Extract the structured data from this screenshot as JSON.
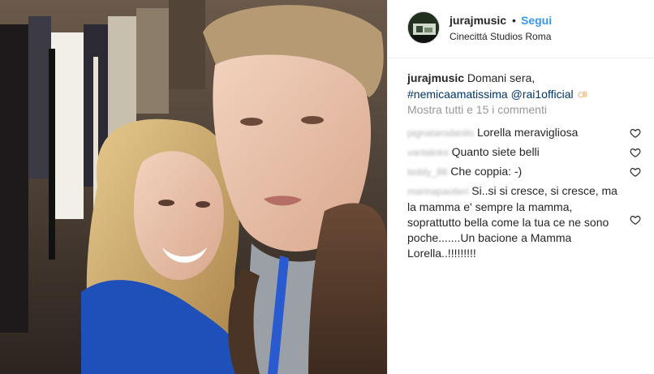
{
  "post": {
    "username": "jurajmusic",
    "separator": "•",
    "follow_label": "Segui",
    "location": "Cinecittá Studios Roma"
  },
  "caption": {
    "username": "jurajmusic",
    "text_line1": "Domani sera,",
    "hashtag": "#nemicaamatissima",
    "mention": "@rai1official",
    "emoji_icon": "ok-hand-emoji"
  },
  "show_all_comments": "Mostra tutti e 15 i commenti",
  "comments": [
    {
      "user": "pignatarodanilo",
      "text": "Lorella meravigliosa"
    },
    {
      "user": "vantaloloi",
      "text": "Quanto siete belli"
    },
    {
      "user": "teddy_88",
      "text": "Che coppia: -)"
    },
    {
      "user": "marinapaolieri",
      "text": "Si..si si cresce, si cresce, ma la mamma e' sempre la mamma, soprattutto bella come la tua ce ne sono poche.......Un bacione a Mamma Lorella..!!!!!!!!!"
    }
  ],
  "colors": {
    "link": "#003569",
    "follow": "#3897f0",
    "muted": "#999999",
    "text": "#262626"
  }
}
